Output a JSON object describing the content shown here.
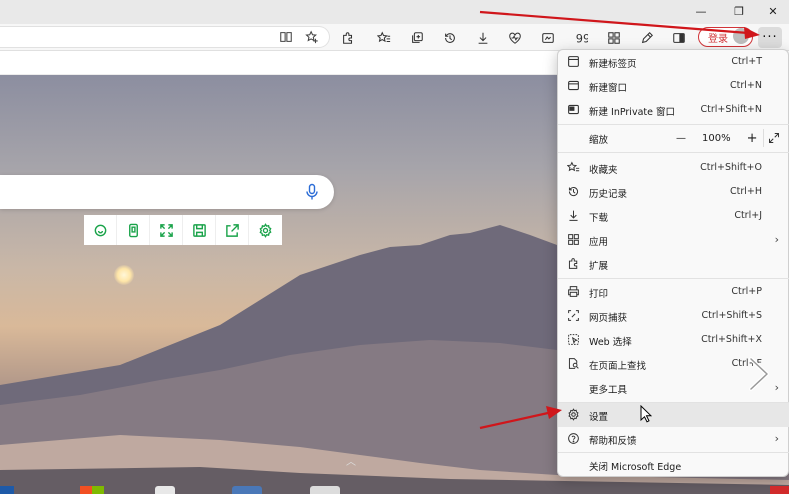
{
  "toolbar": {
    "login_label": "登录",
    "more_label": "···"
  },
  "titlebar": {
    "minimize": "—",
    "restore": "❐",
    "close": "✕"
  },
  "menu": {
    "items": [
      {
        "label": "新建标签页",
        "shortcut": "Ctrl+T",
        "icon": "new-tab-icon"
      },
      {
        "label": "新建窗口",
        "shortcut": "Ctrl+N",
        "icon": "new-window-icon"
      },
      {
        "label": "新建 InPrivate 窗口",
        "shortcut": "Ctrl+Shift+N",
        "icon": "inprivate-icon"
      },
      {
        "label": "缩放",
        "shortcut": "",
        "icon": ""
      },
      {
        "label": "收藏夹",
        "shortcut": "Ctrl+Shift+O",
        "icon": "favorites-icon"
      },
      {
        "label": "历史记录",
        "shortcut": "Ctrl+H",
        "icon": "history-icon"
      },
      {
        "label": "下载",
        "shortcut": "Ctrl+J",
        "icon": "download-icon"
      },
      {
        "label": "应用",
        "shortcut": "",
        "icon": "apps-icon"
      },
      {
        "label": "扩展",
        "shortcut": "",
        "icon": "extensions-icon"
      },
      {
        "label": "打印",
        "shortcut": "Ctrl+P",
        "icon": "print-icon"
      },
      {
        "label": "网页捕获",
        "shortcut": "Ctrl+Shift+S",
        "icon": "capture-icon"
      },
      {
        "label": "Web 选择",
        "shortcut": "Ctrl+Shift+X",
        "icon": "web-select-icon"
      },
      {
        "label": "在页面上查找",
        "shortcut": "Ctrl+F",
        "icon": "find-icon"
      },
      {
        "label": "更多工具",
        "shortcut": "",
        "icon": ""
      },
      {
        "label": "设置",
        "shortcut": "",
        "icon": "gear-icon"
      },
      {
        "label": "帮助和反馈",
        "shortcut": "",
        "icon": "help-icon"
      },
      {
        "label": "关闭 Microsoft Edge",
        "shortcut": "",
        "icon": ""
      }
    ],
    "zoom": {
      "minus": "—",
      "value": "100%",
      "plus": "+"
    }
  },
  "colors": {
    "accent_red": "#d13438",
    "green_tool": "#1aa34a"
  }
}
